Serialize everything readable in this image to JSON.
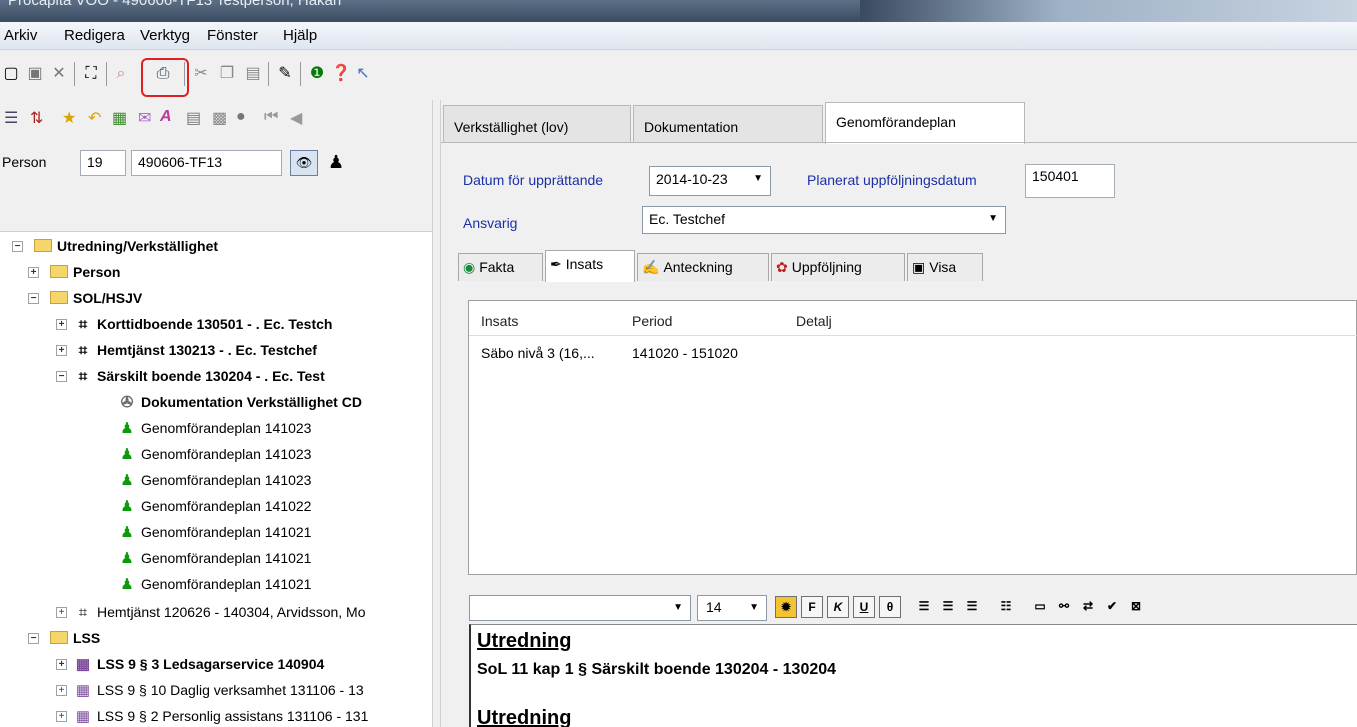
{
  "window": {
    "title": "Procapita VOO - 490606-TF13 Testperson, Håkan"
  },
  "menu": [
    "Arkiv",
    "Redigera",
    "Verktyg",
    "Fönster",
    "Hjälp"
  ],
  "person": {
    "label": "Person",
    "number": "19",
    "pnr": "490606-TF13"
  },
  "tree": {
    "root": "Utredning/Verkställighet",
    "person": "Person",
    "sol": "SOL/HSJV",
    "kort": "Korttidboende 130501 - . Ec. Testch",
    "hemtj1": "Hemtjänst 130213 - . Ec. Testchef",
    "sarskilt": "Särskilt boende 130204 - . Ec. Test",
    "dok": "Dokumentation Verkställighet CD",
    "gp": [
      "Genomförandeplan 141023",
      "Genomförandeplan 141023",
      "Genomförandeplan 141023",
      "Genomförandeplan 141022",
      "Genomförandeplan 141021",
      "Genomförandeplan 141021",
      "Genomförandeplan 141021"
    ],
    "hemtj2": "Hemtjänst 120626 - 140304, Arvidsson, Mo",
    "lss": "LSS",
    "lss1": "LSS 9 § 3 Ledsagarservice 140904",
    "lss2": "LSS 9 § 10 Daglig verksamhet 131106 - 13",
    "lss3": "LSS 9 § 2 Personlig assistans 131106 - 131"
  },
  "tabs": [
    "Verkställighet (lov)",
    "Dokumentation",
    "Genomförandeplan"
  ],
  "form": {
    "datum_label": "Datum för upprättande",
    "datum_value": "2014-10-23",
    "uppf_label": "Planerat uppföljningsdatum",
    "uppf_value": "150401",
    "ansvarig_label": "Ansvarig",
    "ansvarig_value": "Ec. Testchef"
  },
  "inner_tabs": [
    "Fakta",
    "Insats",
    "Anteckning",
    "Uppföljning",
    "Visa"
  ],
  "list": {
    "headers": [
      "Insats",
      "Period",
      "Detalj"
    ],
    "row": {
      "insats": "Säbo nivå 3 (16,...",
      "period": "141020 - 151020",
      "detalj": ""
    }
  },
  "editor": {
    "font_size": "14",
    "format_buttons": [
      "F",
      "K",
      "U"
    ],
    "heading": "Utredning",
    "line": "SoL 11 kap 1 § Särskilt boende 130204 - 130204",
    "heading2": "Utredning"
  },
  "icons": {
    "highlight_color": "#e02020",
    "link_color": "#1a2fa8"
  }
}
